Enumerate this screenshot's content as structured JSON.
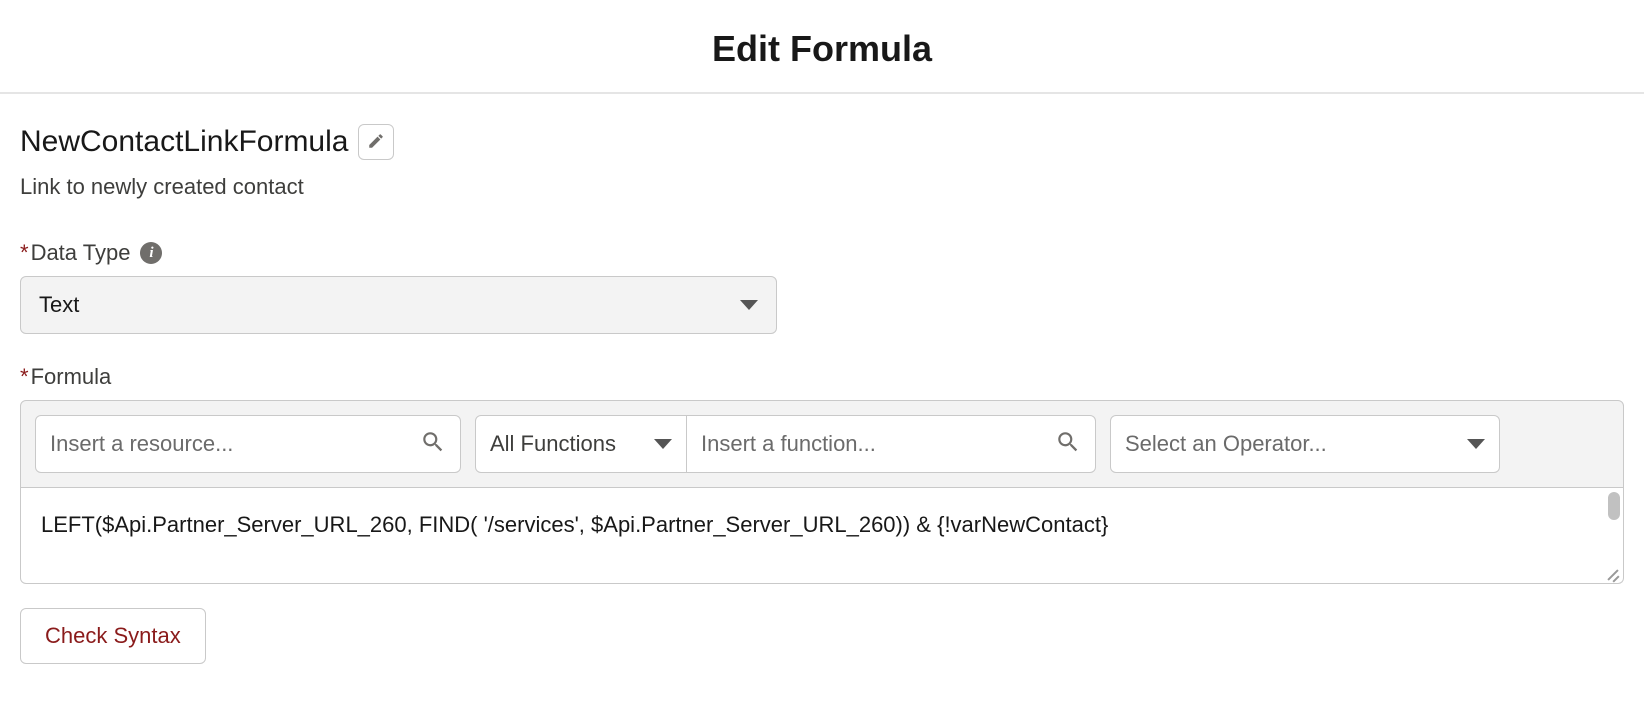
{
  "header": {
    "title": "Edit Formula"
  },
  "formula": {
    "name": "NewContactLinkFormula",
    "description": "Link to newly created contact"
  },
  "dataType": {
    "label": "Data Type",
    "value": "Text"
  },
  "formulaSection": {
    "label": "Formula",
    "resourcePlaceholder": "Insert a resource...",
    "functionsFilter": "All Functions",
    "functionPlaceholder": "Insert a function...",
    "operatorPlaceholder": "Select an Operator...",
    "expression": "LEFT($Api.Partner_Server_URL_260, FIND( '/services', $Api.Partner_Server_URL_260)) & {!varNewContact}"
  },
  "buttons": {
    "checkSyntax": "Check Syntax"
  }
}
